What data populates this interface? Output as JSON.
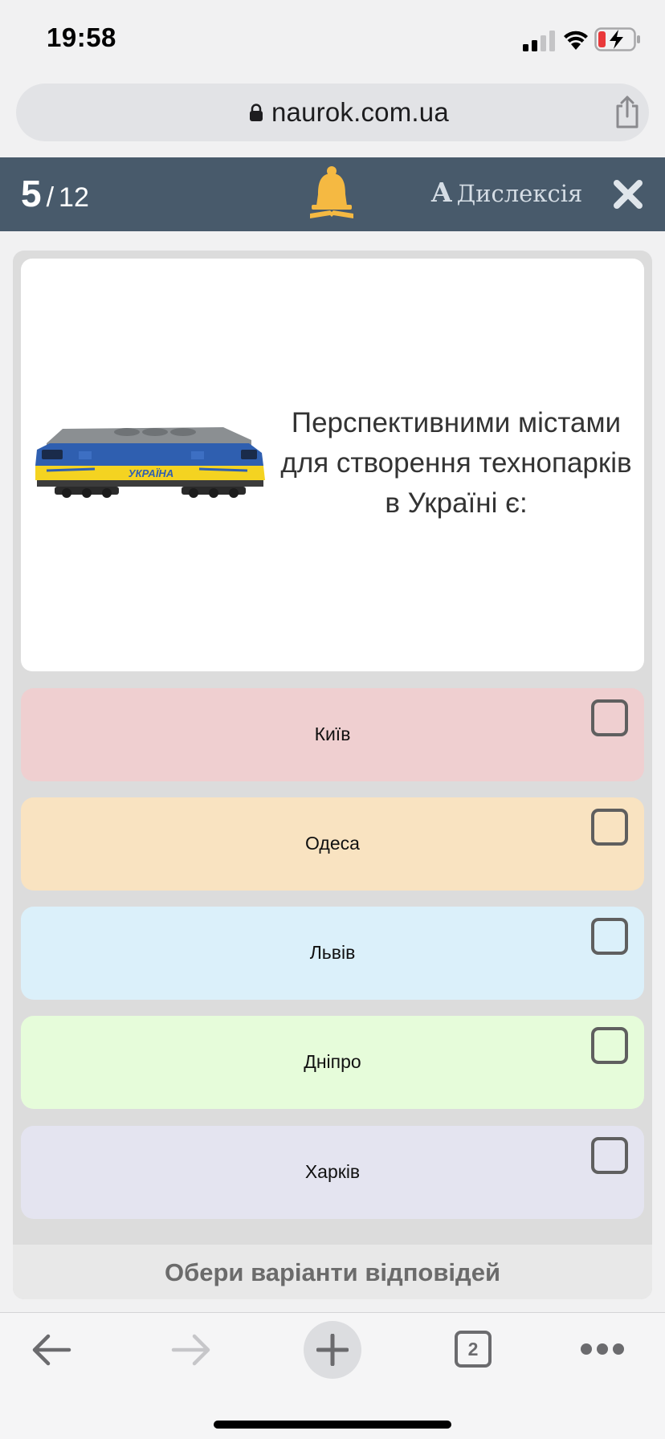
{
  "status_bar": {
    "time": "19:58",
    "icons": [
      "signal-icon",
      "wifi-icon",
      "battery-charging-icon"
    ]
  },
  "browser": {
    "url": "naurok.com.ua",
    "icons": [
      "lock-icon",
      "share-icon"
    ]
  },
  "quiz_header": {
    "current_question": "5",
    "separator": "/",
    "total_questions": "12",
    "dyslexia_icon_letter": "A",
    "dyslexia_label": "Дислексія",
    "icons": [
      "bell-icon",
      "close-icon"
    ]
  },
  "question": {
    "text": "Перспективними містами для створення технопарків в Україні є:",
    "image": {
      "name": "locomotive-image",
      "inscription": "УКРАЇНА"
    }
  },
  "answers": [
    {
      "label": "Київ",
      "color": "#efcfd0",
      "checked": false
    },
    {
      "label": "Одеса",
      "color": "#f9e3c1",
      "checked": false
    },
    {
      "label": "Львів",
      "color": "#dbf0fa",
      "checked": false
    },
    {
      "label": "Дніпро",
      "color": "#e6fcda",
      "checked": false
    },
    {
      "label": "Харків",
      "color": "#e4e4f0",
      "checked": false
    }
  ],
  "submit_label": "Обери варіанти відповідей",
  "toolbar": {
    "tab_count": "2",
    "icons": [
      "back-arrow-icon",
      "forward-arrow-icon",
      "plus-icon",
      "tabs-icon",
      "more-icon"
    ]
  },
  "colors": {
    "header_bg": "#485a6b",
    "bell": "#f5b942",
    "panel_bg": "#dcdcdc"
  }
}
